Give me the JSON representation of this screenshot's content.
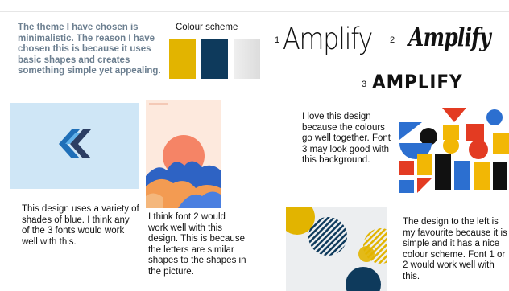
{
  "intro": "The theme I have chosen is minimalistic. The reason I have chosen this is because it uses basic shapes and creates something simple yet appealing.",
  "colour_scheme": {
    "title": "Colour scheme",
    "swatches": [
      "#e2b400",
      "#0e3a5c",
      "#e7e7e7"
    ]
  },
  "fonts": {
    "num1": "1",
    "num2": "2",
    "num3": "3",
    "font1": "Amplify",
    "font2": "Amplify",
    "font3": "AMPLIFY"
  },
  "notes": {
    "logo_note": "This design uses a variety of shades of blue. I think any of the 3 fonts would work well with this.",
    "sunset_note": "I think font 2 would work well with this design. This is because the letters are similar shapes to the shapes in the picture.",
    "geometric_note": "I love this design because the colours go well together. Font 3 may look good with this background.",
    "circles_note": "The design to the left is my favourite because it is simple and it has a nice colour scheme. Font 1 or 2 would work well with this."
  },
  "colors": {
    "intro_text": "#6c7f90",
    "logo_bg": "#cfe6f6",
    "sunset_bg": "#fde9dd",
    "navy": "#0e3a5c",
    "yellow": "#e2b400",
    "red": "#e33b22",
    "blue": "#2c6fd0"
  }
}
